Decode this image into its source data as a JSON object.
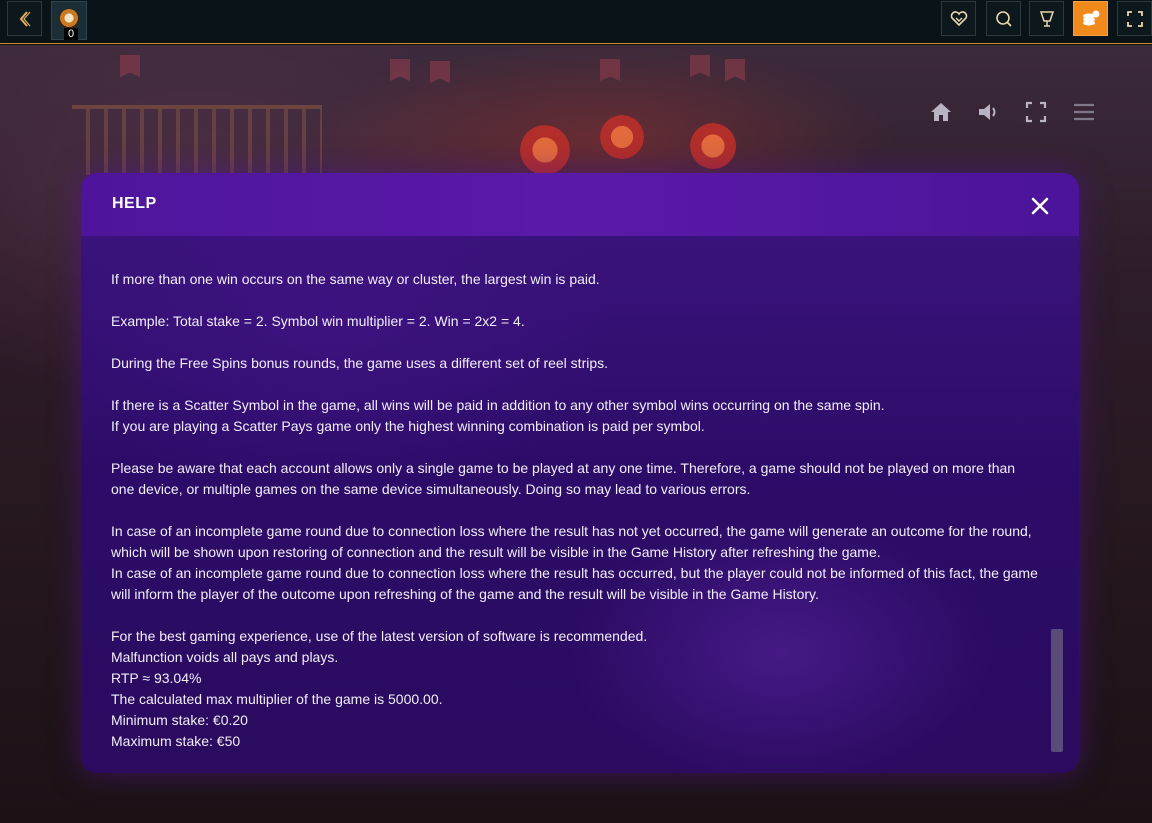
{
  "topbar": {
    "back_icon": "chevron-left-icon",
    "counter_value": "0",
    "right_icons": [
      "favorite-heart-icon",
      "search-icon",
      "trophy-icon",
      "coins-icon",
      "fullscreen-icon"
    ],
    "accent_color": "#f08a1c"
  },
  "game_controls": {
    "icons": [
      "home-icon",
      "sound-icon",
      "fullscreen-icon",
      "menu-icon"
    ]
  },
  "help": {
    "title": "HELP",
    "paragraphs": [
      [
        "If more than one win occurs on the same way or cluster, the largest win is paid."
      ],
      [
        "Example: Total stake = 2. Symbol win multiplier = 2. Win = 2x2 = 4."
      ],
      [
        "During the Free Spins bonus rounds, the game uses a different set of reel strips."
      ],
      [
        "If there is a Scatter Symbol in the game, all wins will be paid in addition to any other symbol wins occurring on the same spin.",
        "If you are playing a Scatter Pays game only the highest winning combination is paid per symbol."
      ],
      [
        "Please be aware that each account allows only a single game to be played at any one time. Therefore, a game should not be played on more than one device, or multiple games on the same device simultaneously. Doing so may lead to various errors."
      ],
      [
        "In case of an incomplete game round due to connection loss where the result has not yet occurred, the game will generate an outcome for the round, which will be shown upon restoring of connection and the result will be visible in the Game History after refreshing the game.",
        "In case of an incomplete game round due to connection loss where the result has occurred, but the player could not be informed of this fact, the game will inform the player of the outcome upon refreshing of the game and the result will be visible in the Game History."
      ],
      [
        "For the best gaming experience, use of the latest version of software is recommended.",
        "Malfunction voids all pays and plays.",
        "RTP ≈ 93.04%",
        "The calculated max multiplier of the game is 5000.00.",
        "Minimum stake: €0.20",
        "Maximum stake: €50"
      ]
    ]
  },
  "colors": {
    "modal_bg": "#2c0c68",
    "modal_header": "#5a1aa8",
    "scrollbar_thumb": "#5a4b78"
  }
}
